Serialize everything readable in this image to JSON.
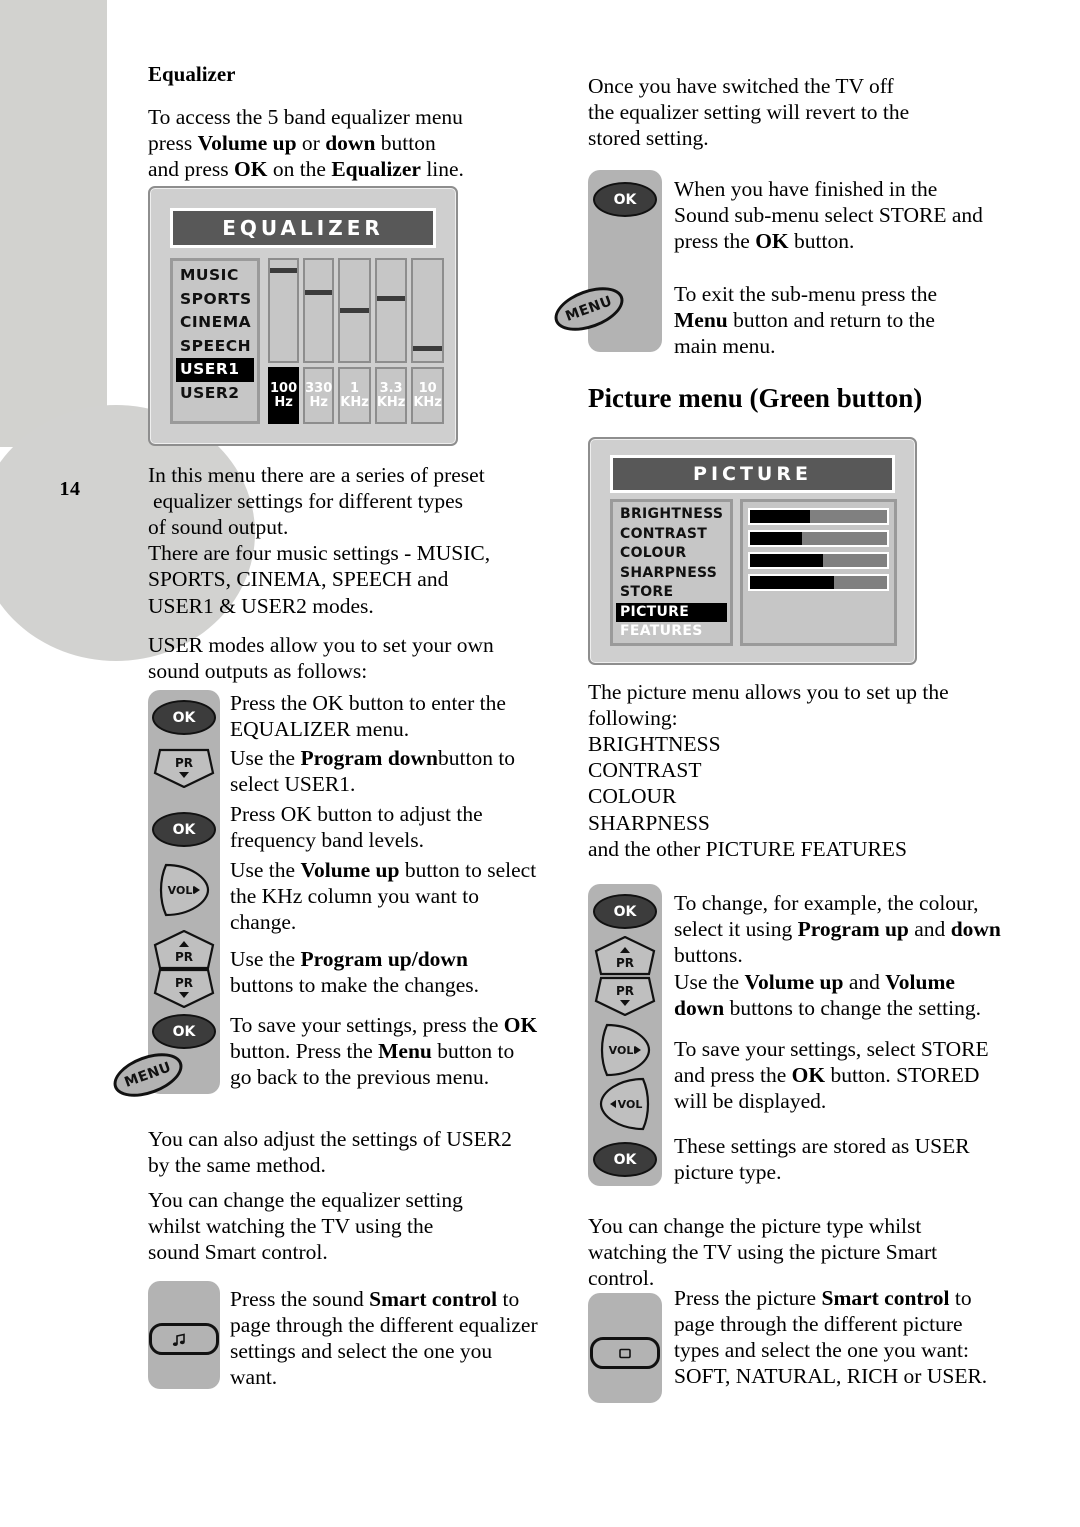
{
  "page": {
    "number": "14"
  },
  "left_column": {
    "heading": "Equalizer",
    "intro": [
      {
        "t": "To access the 5 band equalizer menu",
        "b": false
      },
      {
        "t": "press ",
        "b": false
      },
      {
        "t": "Volume up",
        "b": true
      },
      {
        "t": " or ",
        "b": false
      },
      {
        "t": "down",
        "b": true
      },
      {
        "t": " button",
        "b": false
      },
      {
        "t": "and press  ",
        "b": false
      },
      {
        "t": "OK",
        "b": true
      },
      {
        "t": " on the ",
        "b": false
      },
      {
        "t": "Equalizer",
        "b": true
      },
      {
        "t": " line.",
        "b": false
      }
    ],
    "para_preset_1": "In this menu there are a series of preset",
    "para_preset_2": "equalizer settings for different types",
    "para_preset_3": "of sound output.",
    "para_preset_4": "There are four music settings - MUSIC,",
    "para_preset_5": "SPORTS, CINEMA, SPEECH and",
    "para_preset_6": "USER1 & USER2 modes.",
    "para_user_1": "USER modes allow you to set your own",
    "para_user_2": "sound outputs as follows:",
    "para_user2_1": "You can also adjust the settings of USER2",
    "para_user2_2": "by the same method.",
    "para_smart_1": "You can change the equalizer setting",
    "para_smart_2": "whilst watching the TV using the",
    "para_smart_3": "sound Smart control.",
    "steps": [
      {
        "icon": "ok-button-icon",
        "label": "OK",
        "lines": [
          [
            {
              "t": "Press the OK button to enter the",
              "b": false
            }
          ],
          [
            {
              "t": "EQUALIZER menu.",
              "b": false
            }
          ]
        ]
      },
      {
        "icon": "program-down-button-icon",
        "label": "PR",
        "lines": [
          [
            {
              "t": "Use the  ",
              "b": false
            },
            {
              "t": "Program down",
              "b": true
            },
            {
              "t": "button to",
              "b": false
            }
          ],
          [
            {
              "t": "select  USER1.",
              "b": false
            }
          ]
        ]
      },
      {
        "icon": "ok-button-icon",
        "label": "OK",
        "lines": [
          [
            {
              "t": "Press OK button to adjust the",
              "b": false
            }
          ],
          [
            {
              "t": "frequency band levels.",
              "b": false
            }
          ]
        ]
      },
      {
        "icon": "volume-up-button-icon",
        "label": "VOL",
        "lines": [
          [
            {
              "t": "Use the  ",
              "b": false
            },
            {
              "t": "Volume up",
              "b": true
            },
            {
              "t": " button to select",
              "b": false
            }
          ],
          [
            {
              "t": "the KHz column you want to",
              "b": false
            }
          ],
          [
            {
              "t": "change.",
              "b": false
            }
          ]
        ]
      },
      {
        "icon": "program-up-down-button-icon",
        "label": "PR",
        "lines": [
          [
            {
              "t": "Use the ",
              "b": false
            },
            {
              "t": "Program up/down",
              "b": true
            }
          ],
          [
            {
              "t": "buttons to make the changes.",
              "b": false
            }
          ]
        ]
      },
      {
        "icon": "ok-menu-button-icon",
        "label": "OK",
        "lines": [
          [
            {
              "t": "To save your settings, press the ",
              "b": false
            },
            {
              "t": "OK",
              "b": true
            }
          ],
          [
            {
              "t": "button. Press the ",
              "b": false
            },
            {
              "t": "Menu",
              "b": true
            },
            {
              "t": " button to",
              "b": false
            }
          ],
          [
            {
              "t": "go back to the previous menu.",
              "b": false
            }
          ]
        ]
      }
    ],
    "smart_control": {
      "icon": "sound-smart-control-icon",
      "glyph": "music-note-icon",
      "lines": [
        [
          {
            "t": "Press the sound ",
            "b": false
          },
          {
            "t": "Smart control",
            "b": true
          },
          {
            "t": " to",
            "b": false
          }
        ],
        [
          {
            "t": "page through the different equalizer",
            "b": false
          }
        ],
        [
          {
            "t": "settings and select the one you",
            "b": false
          }
        ],
        [
          {
            "t": " want.",
            "b": false
          }
        ]
      ]
    }
  },
  "equalizer_screen": {
    "title": "EQUALIZER",
    "presets": [
      "MUSIC",
      "SPORTS",
      "CINEMA",
      "SPEECH",
      "USER1",
      "USER2"
    ],
    "selected_preset": "USER1",
    "bands": [
      {
        "label_top": "100",
        "label_bottom": "Hz",
        "level_pct": 8,
        "selected": true
      },
      {
        "label_top": "330",
        "label_bottom": "Hz",
        "level_pct": 30,
        "selected": false
      },
      {
        "label_top": "1",
        "label_bottom": "KHz",
        "level_pct": 48,
        "selected": false
      },
      {
        "label_top": "3.3",
        "label_bottom": "KHz",
        "level_pct": 36,
        "selected": false
      },
      {
        "label_top": "10",
        "label_bottom": "KHz",
        "level_pct": 85,
        "selected": false
      }
    ]
  },
  "right_column": {
    "para_revert_1": "Once you have switched the TV off",
    "para_revert_2": "the equalizer setting will revert to the",
    "para_revert_3": "stored setting.",
    "heading": "Picture menu (Green button)",
    "steps_top": [
      {
        "icon": "ok-button-icon",
        "label": "OK",
        "lines": [
          [
            {
              "t": "When you have finished in the",
              "b": false
            }
          ],
          [
            {
              "t": "Sound sub-menu select STORE and",
              "b": false
            }
          ],
          [
            {
              "t": "press the ",
              "b": false
            },
            {
              "t": "OK",
              "b": true
            },
            {
              "t": " button.",
              "b": false
            }
          ]
        ]
      },
      {
        "icon": "menu-button-icon",
        "label": "MENU",
        "lines": [
          [
            {
              "t": "To exit the sub-menu press the",
              "b": false
            }
          ],
          [
            {
              "t": "Menu",
              "b": true
            },
            {
              "t": " button and return to the",
              "b": false
            }
          ],
          [
            {
              "t": "main menu.",
              "b": false
            }
          ]
        ]
      }
    ],
    "para_allows_1": "The picture menu allows you to set up the",
    "para_allows_2": "following:",
    "feature_list": [
      "BRIGHTNESS",
      "CONTRAST",
      "COLOUR",
      "SHARPNESS"
    ],
    "para_allows_3": "and the other PICTURE FEATURES",
    "steps_bottom": [
      {
        "icon": "ok-program-buttons-icon",
        "label": "OK",
        "lines": [
          [
            {
              "t": "To change, for example, the colour,",
              "b": false
            }
          ],
          [
            {
              "t": "select it using ",
              "b": false
            },
            {
              "t": "Program up",
              "b": true
            },
            {
              "t": " and ",
              "b": false
            },
            {
              "t": "down",
              "b": true
            }
          ],
          [
            {
              "t": "buttons.",
              "b": false
            }
          ]
        ]
      },
      {
        "icon": "program-up-down-button-icon",
        "label": "PR",
        "lines": [
          [
            {
              "t": "Use the ",
              "b": false
            },
            {
              "t": "Volume up",
              "b": true
            },
            {
              "t": "  and ",
              "b": false
            },
            {
              "t": "Volume",
              "b": true
            }
          ],
          [
            {
              "t": "down",
              "b": true
            },
            {
              "t": "  buttons to change the setting.",
              "b": false
            }
          ]
        ]
      },
      {
        "icon": "volume-buttons-icon",
        "label": "VOL",
        "lines": [
          [
            {
              "t": "To save your settings, select STORE",
              "b": false
            }
          ],
          [
            {
              "t": "and press the ",
              "b": false
            },
            {
              "t": "OK",
              "b": true
            },
            {
              "t": " button. STORED",
              "b": false
            }
          ],
          [
            {
              "t": "will be displayed.",
              "b": false
            }
          ]
        ]
      },
      {
        "icon": "ok-button-icon",
        "label": "OK",
        "lines": [
          [
            {
              "t": "These settings are stored as USER",
              "b": false
            }
          ],
          [
            {
              "t": "picture type.",
              "b": false
            }
          ]
        ]
      }
    ],
    "para_pic_smart_1": "You can change the picture type whilst",
    "para_pic_smart_2": "watching the TV using the picture Smart",
    "para_pic_smart_3": "control.",
    "smart_control": {
      "icon": "picture-smart-control-icon",
      "glyph": "screen-icon",
      "lines": [
        [
          {
            "t": "Press the picture ",
            "b": false
          },
          {
            "t": "Smart control",
            "b": true
          },
          {
            "t": " to",
            "b": false
          }
        ],
        [
          {
            "t": "page through the different picture",
            "b": false
          }
        ],
        [
          {
            "t": "types and select the one you want:",
            "b": false
          }
        ],
        [
          {
            "t": "SOFT, NATURAL, RICH or USER.",
            "b": false
          }
        ]
      ]
    }
  },
  "picture_screen": {
    "title": "PICTURE",
    "items": [
      "BRIGHTNESS",
      "CONTRAST",
      "COLOUR",
      "SHARPNESS",
      "STORE",
      "PICTURE FEATURES"
    ],
    "selected_item": "PICTURE FEATURES",
    "bars": [
      {
        "name": "BRIGHTNESS",
        "value_pct": 44
      },
      {
        "name": "CONTRAST",
        "value_pct": 38
      },
      {
        "name": "COLOUR",
        "value_pct": 53
      },
      {
        "name": "SHARPNESS",
        "value_pct": 61
      }
    ]
  },
  "colors": {
    "panel_grey": "#b3b3b3",
    "osd_grey": "#cfcfcf",
    "osd_title_grey": "#585858",
    "selection_black": "#000000",
    "decoration_grey": "#d2d2cf"
  }
}
